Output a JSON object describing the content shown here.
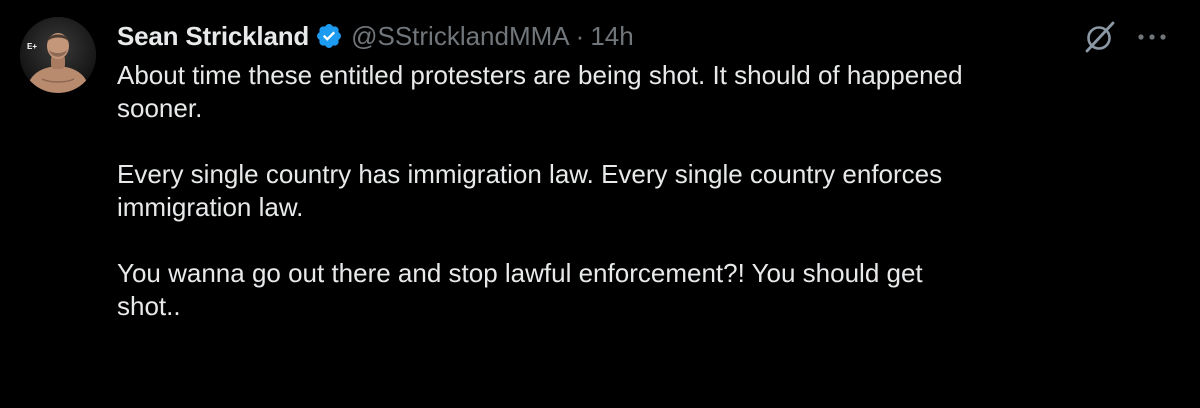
{
  "tweet": {
    "display_name": "Sean Strickland",
    "handle": "@SStricklandMMA",
    "separator": "·",
    "time": "14h",
    "avatar_badge": "E+",
    "paragraphs": [
      [
        "About time these entitled protesters are being shot. It should of happened",
        "sooner."
      ],
      [
        "Every single country has immigration law. Every single country enforces",
        "immigration law."
      ],
      [
        "You wanna go out there and stop lawful enforcement?! You should get",
        "shot.."
      ]
    ]
  },
  "icons": {
    "verified": "verified-badge-icon",
    "grok": "grok-icon",
    "more": "more-horizontal-icon"
  },
  "colors": {
    "background": "#000000",
    "primary_text": "#e7e9ea",
    "secondary_text": "#71767b",
    "verified_blue": "#1d9bf0"
  }
}
